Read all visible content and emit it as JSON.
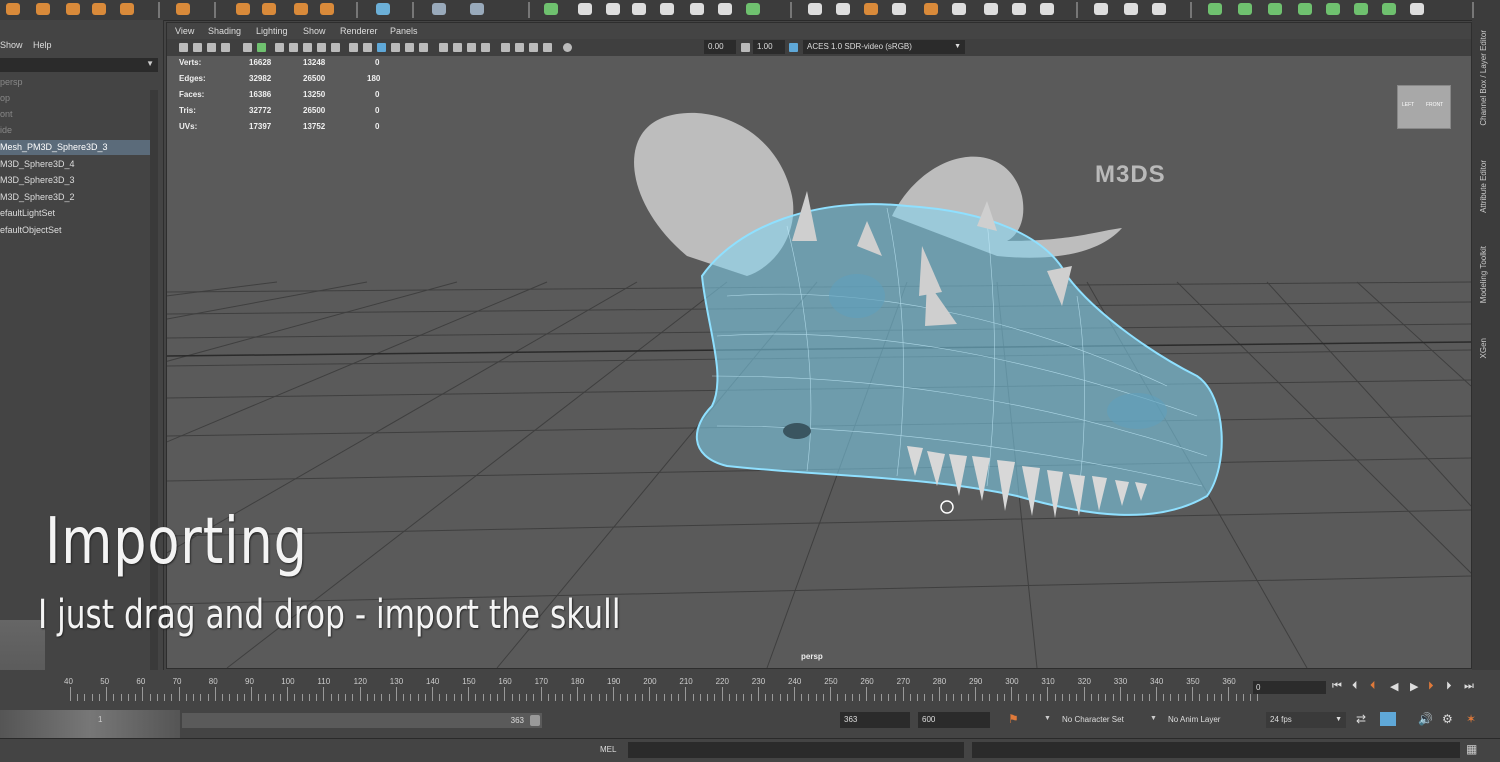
{
  "outliner": {
    "menu": [
      "Show",
      "Help"
    ],
    "items": [
      {
        "label": "persp",
        "state": "dim"
      },
      {
        "label": "op",
        "state": "dim"
      },
      {
        "label": "ont",
        "state": "dim"
      },
      {
        "label": "ide",
        "state": "dim"
      },
      {
        "label": "Mesh_PM3D_Sphere3D_3",
        "state": "selected"
      },
      {
        "label": "M3D_Sphere3D_4",
        "state": "normal"
      },
      {
        "label": "M3D_Sphere3D_3",
        "state": "normal"
      },
      {
        "label": "M3D_Sphere3D_2",
        "state": "normal"
      },
      {
        "label": "efaultLightSet",
        "state": "normal"
      },
      {
        "label": "efaultObjectSet",
        "state": "normal"
      }
    ]
  },
  "viewport": {
    "menu": [
      "View",
      "Shading",
      "Lighting",
      "Show",
      "Renderer",
      "Panels"
    ],
    "exposure": "0.00",
    "gamma": "1.00",
    "color_space": "ACES 1.0 SDR-video (sRGB)",
    "camera_label": "persp",
    "watermark": "M3DS",
    "viewcube": [
      "LEFT",
      "FRONT"
    ],
    "hud": [
      {
        "label": "Verts:",
        "v1": "16628",
        "v2": "13248",
        "v3": "0"
      },
      {
        "label": "Edges:",
        "v1": "32982",
        "v2": "26500",
        "v3": "180"
      },
      {
        "label": "Faces:",
        "v1": "16386",
        "v2": "13250",
        "v3": "0"
      },
      {
        "label": "Tris:",
        "v1": "32772",
        "v2": "26500",
        "v3": "0"
      },
      {
        "label": "UVs:",
        "v1": "17397",
        "v2": "13752",
        "v3": "0"
      }
    ]
  },
  "side_tabs": [
    "Channel Box / Layer Editor",
    "Attribute Editor",
    "Modeling Toolkit",
    "XGen"
  ],
  "overlay": {
    "title": "Importing",
    "subtitle": "I just drag and drop - import the skull"
  },
  "timeline": {
    "ticks": [
      "40",
      "50",
      "60",
      "70",
      "80",
      "90",
      "100",
      "110",
      "120",
      "130",
      "140",
      "150",
      "160",
      "170",
      "180",
      "190",
      "200",
      "210",
      "220",
      "230",
      "240",
      "250",
      "260",
      "270",
      "280",
      "290",
      "300",
      "310",
      "320",
      "330",
      "340",
      "350",
      "360"
    ],
    "current_frame": "0",
    "range_start": "1",
    "range_end_handle": "363",
    "anim_end": "363",
    "playback_end": "600",
    "character_set": "No Character Set",
    "anim_layer": "No Anim Layer",
    "fps": "24 fps"
  },
  "command_line": {
    "language": "MEL"
  },
  "colors": {
    "wire": "#7fd4f0",
    "selected_row": "#5b6b7a",
    "panel": "#444444",
    "viewport": "#5a5a5a"
  }
}
